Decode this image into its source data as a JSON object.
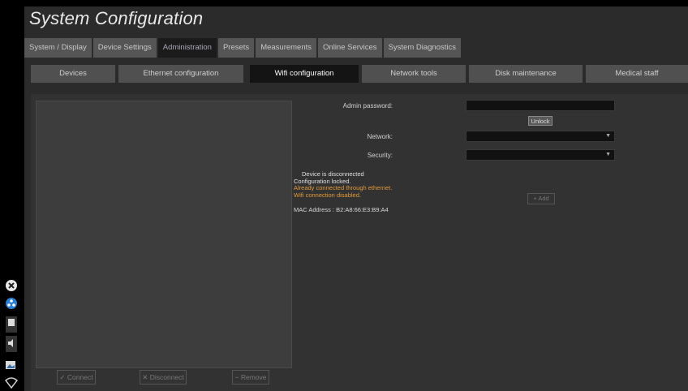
{
  "window": {
    "title": "System Configuration"
  },
  "tabs": [
    "System / Display",
    "Device Settings",
    "Administration",
    "Presets",
    "Measurements",
    "Online Services",
    "System Diagnostics"
  ],
  "active_tab": "Administration",
  "subtabs": [
    "Devices",
    "Ethernet configuration",
    "Wifi configuration",
    "Network tools",
    "Disk maintenance",
    "Medical staff"
  ],
  "active_subtab": "Wifi configuration",
  "list_buttons": {
    "connect": "✓ Connect",
    "disconnect": "✕ Disconnect",
    "remove": "− Remove"
  },
  "form": {
    "admin_password_label": "Admin password:",
    "admin_password_value": "",
    "unlock_label": "Unlock",
    "network_label": "Network:",
    "network_value": "",
    "security_label": "Security:",
    "security_value": "",
    "add_label": "+ Add"
  },
  "status": {
    "line1": "Device is disconnected",
    "line2": "Configuration locked.",
    "line3": "Already connected through ethernet.",
    "line4": "Wifi connection disabled."
  },
  "mac_address": "MAC Address : B2:A8:66:E3:B9:A4",
  "colors": {
    "background": "#2b2b2b",
    "warning": "#e39a3a",
    "active_tab_text": "#a8a8b8"
  },
  "side_icons": [
    "close-circle-icon",
    "network-circle-icon",
    "document-icon",
    "speaker-icon",
    "image-icon",
    "wifi-icon"
  ]
}
